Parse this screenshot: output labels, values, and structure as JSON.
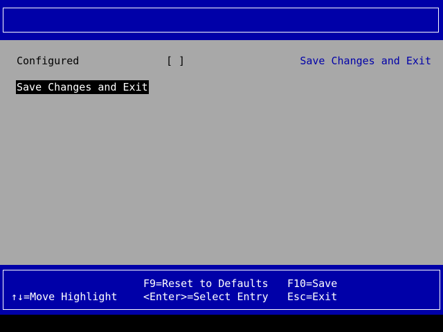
{
  "header": {
    "title": ""
  },
  "settings": {
    "configured_label": "Configured",
    "configured_value": "[ ]"
  },
  "menu": {
    "items": [
      {
        "label": "Save Changes and Exit",
        "selected": true
      }
    ]
  },
  "help_panel": {
    "text": "Save Changes and Exit"
  },
  "footer": {
    "move_highlight": "↑↓=Move Highlight",
    "reset_defaults": "F9=Reset to Defaults",
    "select_entry": "<Enter>=Select Entry",
    "save": "F10=Save",
    "exit": "Esc=Exit"
  },
  "colors": {
    "background": "#a8a8a8",
    "bar_blue": "#0000a8",
    "highlight_bg": "#000000",
    "highlight_fg": "#ffffff",
    "help_text": "#0000a8"
  }
}
